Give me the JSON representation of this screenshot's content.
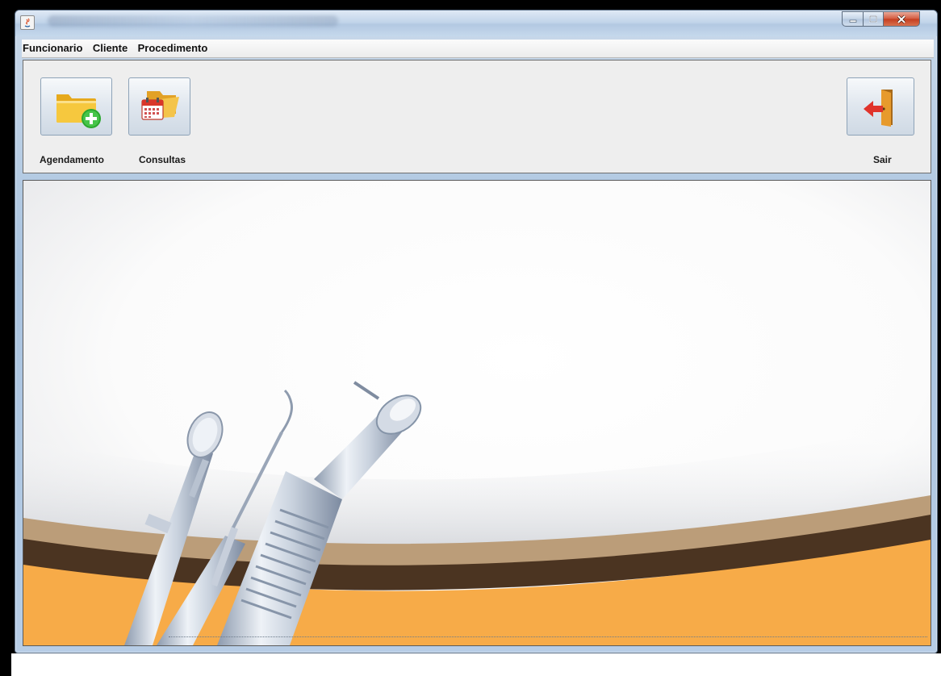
{
  "menu": {
    "items": [
      {
        "label": "Funcionario"
      },
      {
        "label": "Cliente"
      },
      {
        "label": "Procedimento"
      }
    ]
  },
  "toolbar": {
    "agendamento": {
      "label": "Agendamento",
      "icon": "folder-add-icon"
    },
    "consultas": {
      "label": "Consultas",
      "icon": "folder-calendar-icon"
    },
    "sair": {
      "label": "Sair",
      "icon": "exit-door-icon"
    }
  },
  "colors": {
    "accent_orange": "#f6a94a",
    "dark_brown": "#4a3320",
    "tan": "#b99b78",
    "close_red": "#c43d1f"
  },
  "background": {
    "icon": "dental-instruments-illustration"
  }
}
